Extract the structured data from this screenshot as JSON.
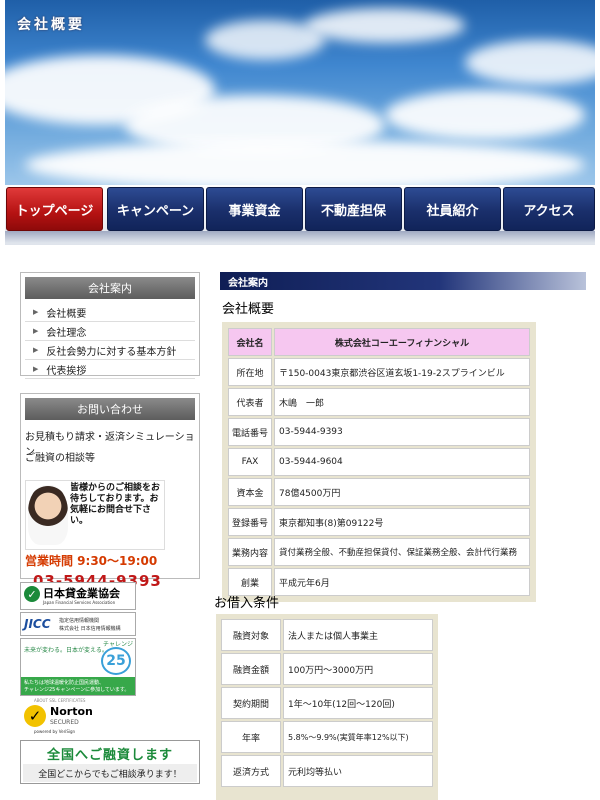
{
  "header": {
    "title": "会社概要"
  },
  "nav": {
    "items": [
      {
        "label": "トップページ",
        "active": true
      },
      {
        "label": "キャンペーン",
        "active": false
      },
      {
        "label": "事業資金",
        "active": false
      },
      {
        "label": "不動産担保",
        "active": false
      },
      {
        "label": "社員紹介",
        "active": false
      },
      {
        "label": "アクセス",
        "active": false
      }
    ]
  },
  "sidebar": {
    "company_box": {
      "title": "会社案内",
      "items": [
        "会社概要",
        "会社理念",
        "反社会勢力に対する基本方針",
        "代表挨拶"
      ]
    },
    "contact_box": {
      "title": "お問い合わせ",
      "links": [
        "お見積もり請求・返済シミュレーション",
        "ご融資の相談等"
      ],
      "operator_message": "皆様からのご相談をお待ちしております。お気軽にお問合せ下さい。",
      "hours": "営業時間 9:30～19:00",
      "phone": "03-5944-9393"
    },
    "badges": {
      "jfsa": {
        "name": "日本貸金業協会",
        "sub": "Japan Financial Services Association"
      },
      "jicc": {
        "name": "JICC",
        "sub1": "指定信用情報機関",
        "sub2": "株式会社 日本信用情報機構"
      },
      "challenge": {
        "tagline": "未来が変わる。日本が変える。",
        "label": "チャレンジ",
        "number": "25",
        "note1": "私たちは地球温暖化防止国民運動、",
        "note2": "チャレンジ25キャンペーンに参加しています。"
      },
      "norton": {
        "click": "ABOUT SSL CERTIFICATES",
        "name": "Norton",
        "secured": "SECURED",
        "powered": "powered by VeriSign"
      },
      "nationwide": {
        "title": "全国へご融資します",
        "sub": "全国どこからでもご相談承ります！"
      }
    }
  },
  "main": {
    "section_header": "会社案内",
    "company_title": "会社概要",
    "company_table": [
      {
        "label": "会社名",
        "value": "株式会社コーエーフィナンシャル"
      },
      {
        "label": "所在地",
        "value": "〒150-0043東京都渋谷区道玄坂1-19-2スプラインビル"
      },
      {
        "label": "代表者",
        "value": "木嶋　一郎"
      },
      {
        "label": "電話番号",
        "value": "03-5944-9393"
      },
      {
        "label": "FAX",
        "value": "03-5944-9604"
      },
      {
        "label": "資本金",
        "value": "78億4500万円"
      },
      {
        "label": "登録番号",
        "value": "東京都知事(8)第09122号"
      },
      {
        "label": "業務内容",
        "value": "貸付業務全般、不動産担保貸付、保証業務全般、会計代行業務"
      },
      {
        "label": "創業",
        "value": "平成元年6月"
      }
    ],
    "loan_title": "お借入条件",
    "loan_table": [
      {
        "label": "融資対象",
        "value": "法人または個人事業主"
      },
      {
        "label": "融資金額",
        "value": "100万円～3000万円"
      },
      {
        "label": "契約期間",
        "value": "1年～10年(12回～120回)"
      },
      {
        "label": "年率",
        "value": "5.8%～9.9%(実質年率12%以下)"
      },
      {
        "label": "返済方式",
        "value": "元利均等払い"
      }
    ]
  }
}
